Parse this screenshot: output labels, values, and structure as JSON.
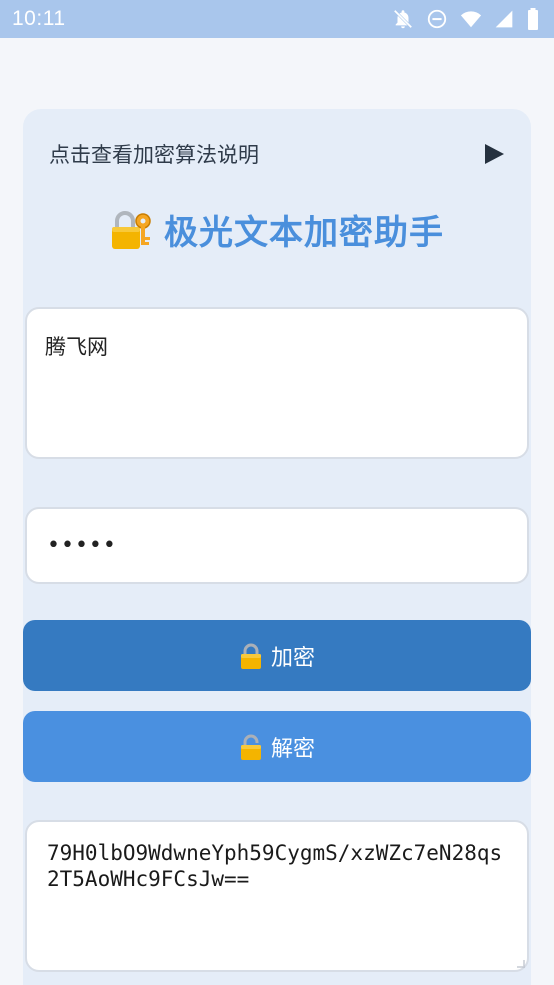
{
  "status_bar": {
    "time": "10:11",
    "icons": [
      "bell-off-icon",
      "do-not-disturb-icon",
      "wifi-icon",
      "signal-icon",
      "battery-icon"
    ]
  },
  "header": {
    "info_text": "点击查看加密算法说明",
    "info_icon": "play-triangle-icon",
    "title": "极光文本加密助手",
    "title_icon": "lock-with-key-icon"
  },
  "form": {
    "input_text": "腾飞网",
    "password_value": "•••••",
    "encrypt_label": "加密",
    "decrypt_label": "解密",
    "output_text": "79H0lbO9WdwneYph59CygmS/xzWZc7eN28qs2T5AoWHc9FCsJw=="
  },
  "colors": {
    "status_bar": "#a9c6ec",
    "card_bg": "#e5edf8",
    "title": "#4a8fdc",
    "encrypt_button": "#357ac1",
    "decrypt_button": "#4a90e0"
  }
}
